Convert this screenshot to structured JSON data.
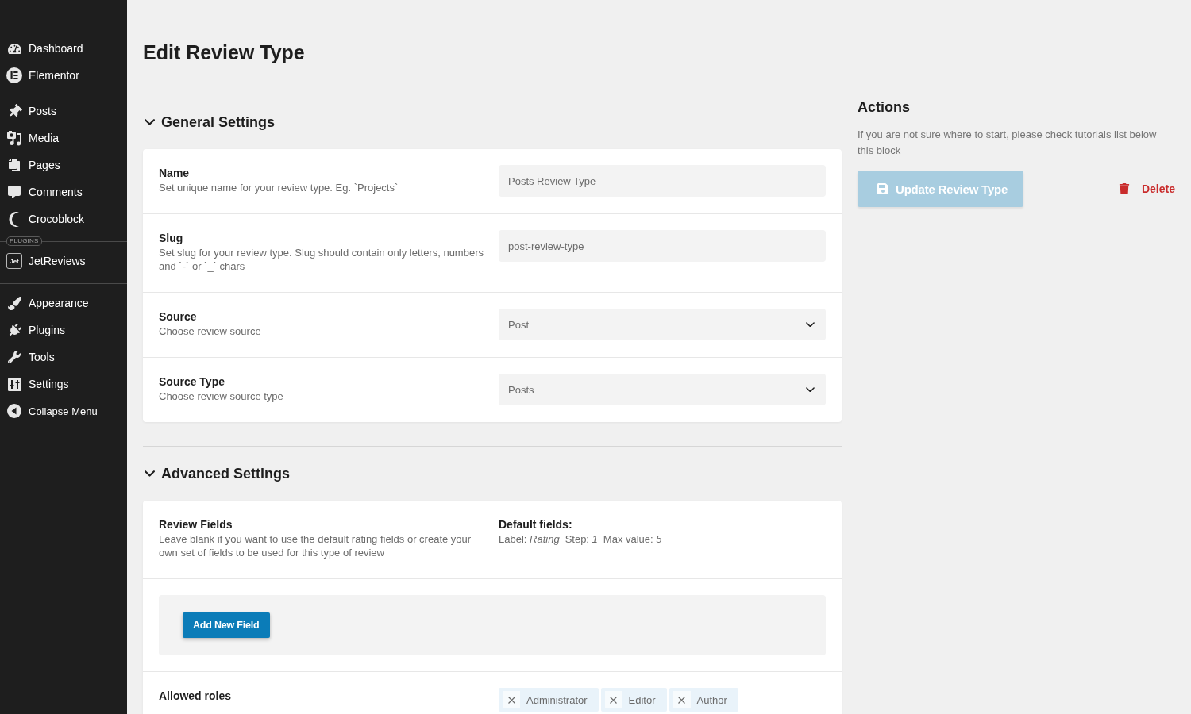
{
  "sidebar": {
    "groups": [
      {
        "divider": false,
        "items": [
          {
            "label": "Dashboard",
            "selected": false
          },
          {
            "label": "Elementor",
            "selected": false
          }
        ]
      },
      {
        "divider": false,
        "items": [
          {
            "label": "Posts",
            "selected": false
          },
          {
            "label": "Media",
            "selected": false
          },
          {
            "label": "Pages",
            "selected": false
          },
          {
            "label": "Comments",
            "selected": false
          },
          {
            "label": "Crocoblock",
            "selected": false
          }
        ]
      },
      {
        "divider": true,
        "divider_label": "PLUGINS",
        "items": [
          {
            "label": "JetReviews",
            "logo_text": "Jet",
            "selected": false
          }
        ]
      },
      {
        "divider": true,
        "items": [
          {
            "label": "Appearance",
            "selected": false
          },
          {
            "label": "Plugins",
            "selected": false
          },
          {
            "label": "Tools",
            "selected": false
          },
          {
            "label": "Settings",
            "selected": false
          }
        ]
      }
    ],
    "collapse": {
      "label": "Collapse Menu"
    }
  },
  "title": "Edit Review Type",
  "sections": [
    {
      "title": "General Settings",
      "expanded": true,
      "rows": [
        {
          "kind": "text",
          "label": "Name",
          "description": "Set unique name for your review type. Eg. `Projects`",
          "value": "Posts Review Type"
        },
        {
          "kind": "text",
          "label": "Slug",
          "description": "Set slug for your review type. Slug should contain only letters, numbers and `-` or `_` chars",
          "value": "post-review-type"
        },
        {
          "kind": "select",
          "label": "Source",
          "description": "Choose review source",
          "value": "Post"
        },
        {
          "kind": "select",
          "label": "Source Type",
          "description": "Choose review source type",
          "value": "Posts"
        }
      ]
    },
    {
      "title": "Advanced Settings",
      "expanded": true,
      "rows": [
        {
          "kind": "info",
          "label": "Review Fields",
          "description": "Leave blank if you want to use the default rating fields or create your own set of fields to be used for this type of review",
          "info_title": "Default fields:",
          "info_items": [
            "Label: *Rating*",
            "Step: *1*",
            "Max value: *5*"
          ]
        },
        {
          "kind": "repeater",
          "button": "Add New Field"
        },
        {
          "kind": "tags",
          "label": "Allowed roles",
          "tags": [
            "Administrator",
            "Editor",
            "Author"
          ]
        }
      ]
    }
  ],
  "actions": {
    "title": "Actions",
    "text": "If you are not sure where to start, please check tutorials list below this block",
    "update_button": {
      "label": "Update Review Type",
      "disabled": true
    },
    "delete_button": {
      "label": "Delete"
    }
  }
}
